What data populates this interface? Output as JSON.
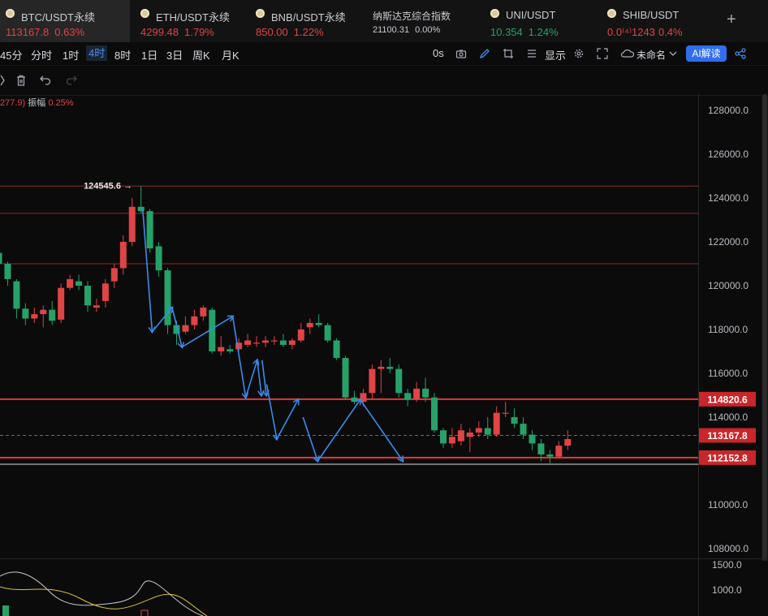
{
  "tabs": [
    {
      "name": "BTC/USDT永续",
      "price": "113167.8",
      "change": "0.63%",
      "dir": "down",
      "active": true
    },
    {
      "name": "ETH/USDT永续",
      "price": "4299.48",
      "change": "1.79%",
      "dir": "down"
    },
    {
      "name": "BNB/USDT永续",
      "price": "850.00",
      "change": "1.22%",
      "dir": "down"
    },
    {
      "name": "纳斯达克综合指数",
      "price": "21100.31",
      "change": "0.00%",
      "dir": "flat"
    },
    {
      "name": "UNI/USDT",
      "price": "10.354",
      "change": "1.24%",
      "dir": "up"
    },
    {
      "name": "SHIB/USDT",
      "price": "0.0⁽⁴⁾1243",
      "change": "0.4%",
      "dir": "down"
    }
  ],
  "add_tab": "+",
  "intervals": [
    "45分",
    "分时",
    "1时",
    "4时",
    "8时",
    "1日",
    "3日",
    "周K",
    "月K"
  ],
  "active_interval": "4时",
  "toolbar": {
    "seconds_label": "0s",
    "display_label": "显示",
    "layout_name": "未命名",
    "ai_label": "AI解读"
  },
  "info": {
    "prefix": "277.9)",
    "amp_label": "振幅",
    "amp_value": "0.25%"
  },
  "colors": {
    "up": "#26a269",
    "down": "#e04444",
    "accent": "#2f6fee",
    "annotation": "#3b8beb"
  },
  "chart_data": {
    "type": "candlestick",
    "y_ticks": [
      "128000.0",
      "126000.0",
      "124000.0",
      "122000.0",
      "120000.0",
      "118000.0",
      "116000.0",
      "114000.0",
      "112000.0",
      "110000.0",
      "108000.0"
    ],
    "high_label": "124545.6",
    "levels": [
      {
        "value": 124545.6
      },
      {
        "value": 123300
      },
      {
        "value": 121000
      },
      {
        "value": 114820.6,
        "label": "114820.6",
        "style": "resistance"
      },
      {
        "value": 112152.8,
        "label": "112152.8",
        "style": "support"
      },
      {
        "value": 111850
      }
    ],
    "last_price": {
      "value": 113167.8,
      "label": "113167.8"
    },
    "candles": [
      [
        121500,
        121000,
        121600,
        119900
      ],
      [
        121000,
        120300,
        121100,
        120000
      ],
      [
        120200,
        118950,
        120300,
        118500
      ],
      [
        118950,
        118500,
        119200,
        118200
      ],
      [
        118500,
        118700,
        119000,
        118300
      ],
      [
        118700,
        118900,
        119100,
        118100
      ],
      [
        118900,
        118400,
        119300,
        118200
      ],
      [
        118450,
        119900,
        120100,
        118300
      ],
      [
        119900,
        120300,
        120500,
        119800
      ],
      [
        120200,
        120000,
        120500,
        119800
      ],
      [
        120000,
        119100,
        120200,
        118800
      ],
      [
        119000,
        119100,
        119400,
        118800
      ],
      [
        119300,
        120100,
        120300,
        119000
      ],
      [
        120200,
        120800,
        121000,
        119900
      ],
      [
        120800,
        122000,
        122300,
        120500
      ],
      [
        122000,
        123600,
        124000,
        121800
      ],
      [
        123600,
        123400,
        124545.6,
        123300
      ],
      [
        123400,
        121700,
        123500,
        121500
      ],
      [
        121800,
        120700,
        122000,
        120400
      ],
      [
        120700,
        118200,
        120800,
        117800
      ],
      [
        118200,
        117800,
        118400,
        117300
      ],
      [
        117900,
        118200,
        118600,
        117800
      ],
      [
        118200,
        118600,
        118900,
        118000
      ],
      [
        118600,
        119000,
        119100,
        118400
      ],
      [
        118900,
        117000,
        119000,
        116900
      ],
      [
        117000,
        117200,
        117700,
        116800
      ],
      [
        117100,
        117000,
        117300,
        116900
      ],
      [
        117100,
        117400,
        117600,
        117000
      ],
      [
        117300,
        117500,
        117800,
        117200
      ],
      [
        117400,
        117400,
        117700,
        117200
      ],
      [
        117400,
        117500,
        117700,
        117200
      ],
      [
        117500,
        117500,
        117700,
        117300
      ],
      [
        117500,
        117300,
        117800,
        117200
      ],
      [
        117300,
        117500,
        117600,
        117100
      ],
      [
        117500,
        118000,
        118300,
        117400
      ],
      [
        118100,
        118300,
        118500,
        117800
      ],
      [
        118300,
        118200,
        118700,
        118100
      ],
      [
        118200,
        117500,
        118300,
        117400
      ],
      [
        117500,
        116700,
        117600,
        116600
      ],
      [
        116700,
        114900,
        116800,
        114800
      ],
      [
        114900,
        114700,
        115200,
        114600
      ],
      [
        114700,
        115100,
        115300,
        114500
      ],
      [
        115100,
        116200,
        116400,
        114800
      ],
      [
        116200,
        116300,
        116600,
        115100
      ],
      [
        116300,
        116200,
        116700,
        116000
      ],
      [
        116200,
        115100,
        116400,
        114900
      ],
      [
        115100,
        114800,
        115300,
        114500
      ],
      [
        114800,
        115300,
        115600,
        114700
      ],
      [
        115300,
        114900,
        115800,
        114700
      ],
      [
        114900,
        113400,
        115100,
        113300
      ],
      [
        113400,
        112800,
        113500,
        112600
      ],
      [
        112800,
        113100,
        113500,
        112600
      ],
      [
        112900,
        113400,
        113700,
        112700
      ],
      [
        113100,
        113300,
        113500,
        112400
      ],
      [
        113300,
        113500,
        113800,
        113100
      ],
      [
        113500,
        113200,
        114000,
        113000
      ],
      [
        113200,
        114200,
        114500,
        113100
      ],
      [
        114200,
        114200,
        114700,
        114000
      ],
      [
        114000,
        113700,
        114400,
        113500
      ],
      [
        113700,
        113200,
        114000,
        113000
      ],
      [
        113200,
        112800,
        113400,
        112500
      ],
      [
        112800,
        112300,
        113000,
        112000
      ],
      [
        112300,
        112200,
        112500,
        111900
      ],
      [
        112200,
        112700,
        112900,
        112100
      ],
      [
        112700,
        113000,
        113400,
        112500
      ]
    ],
    "annotation_paths": [
      [
        [
          125.5,
          123500
        ],
        [
          128.4,
          117900
        ]
      ],
      [
        [
          128.4,
          117900
        ],
        [
          134.5,
          119000
        ]
      ],
      [
        [
          134.5,
          119000
        ],
        [
          137.5,
          117200
        ]
      ],
      [
        [
          137.5,
          117200
        ],
        [
          153,
          118600
        ]
      ],
      [
        [
          153,
          118600
        ],
        [
          157,
          114900
        ]
      ],
      [
        [
          157,
          114900
        ],
        [
          160.5,
          116600
        ]
      ],
      [
        [
          160.5,
          116600
        ],
        [
          161.8,
          115000
        ]
      ],
      [
        [
          162,
          116600
        ],
        [
          163.3,
          115000
        ]
      ],
      [
        [
          163.4,
          115500
        ],
        [
          166.5,
          113000
        ]
      ],
      [
        [
          166.5,
          113000
        ],
        [
          173,
          114800
        ]
      ],
      [
        [
          174.5,
          114000
        ],
        [
          179,
          112000
        ]
      ],
      [
        [
          179,
          112000
        ],
        [
          192,
          114800
        ]
      ],
      [
        [
          192,
          114800
        ],
        [
          205,
          112000
        ]
      ]
    ],
    "oscillator": {
      "y_ticks": [
        "1500.0",
        "1000.0"
      ]
    }
  }
}
